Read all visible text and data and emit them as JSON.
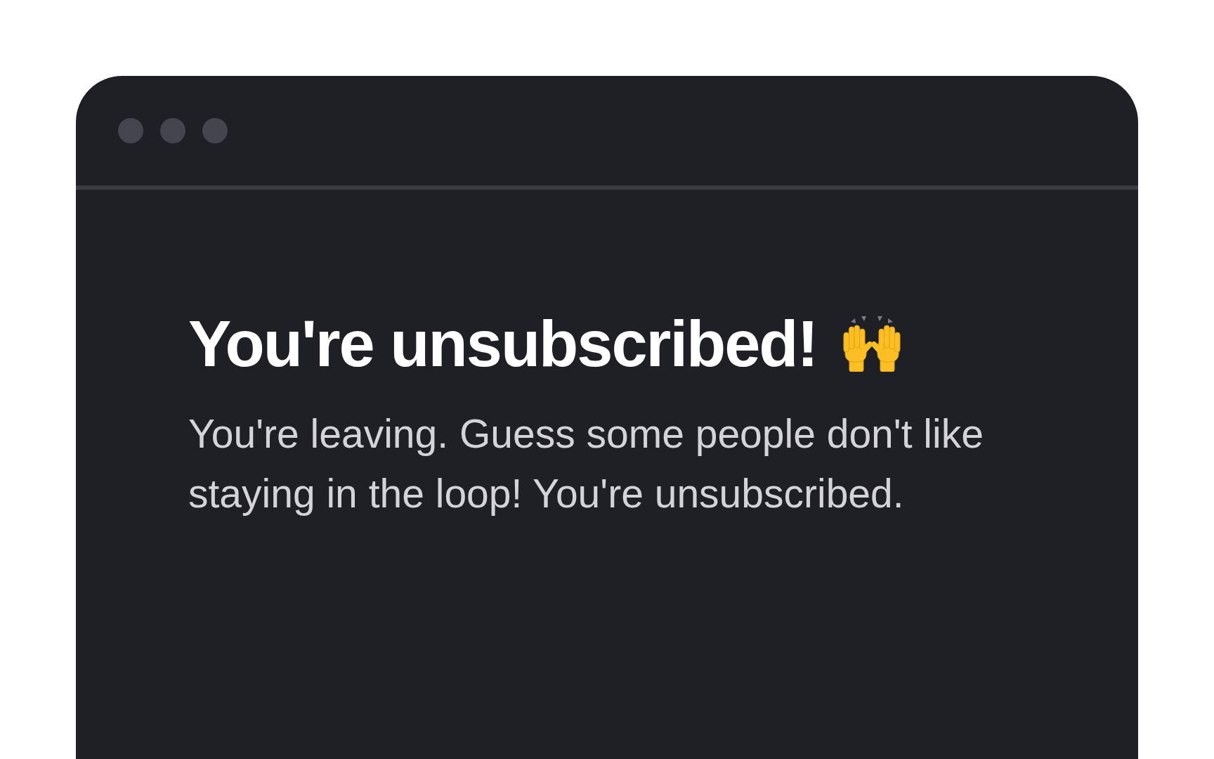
{
  "message": {
    "title": "You're unsubscribed!",
    "body": "You're leaving. Guess some people don't like staying in the loop! You're unsubscribed."
  }
}
